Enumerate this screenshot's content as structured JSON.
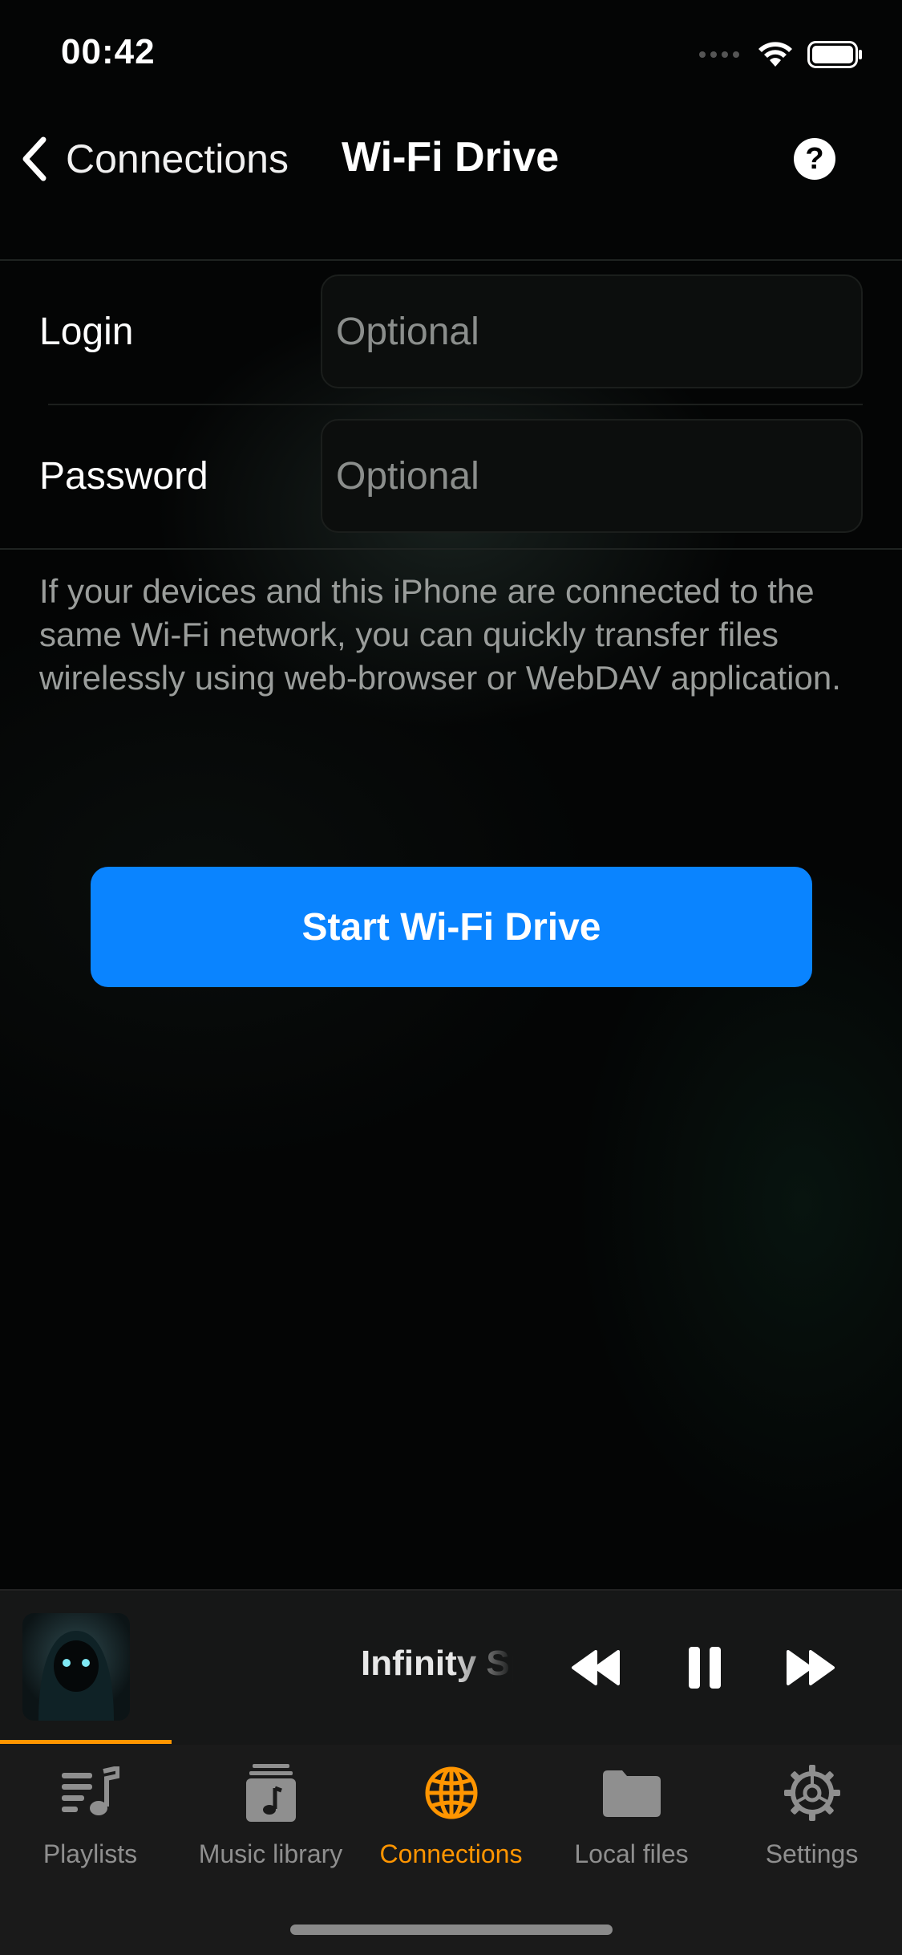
{
  "status_bar": {
    "time": "00:42"
  },
  "nav": {
    "back_label": "Connections",
    "title": "Wi-Fi Drive"
  },
  "form": {
    "login_label": "Login",
    "login_placeholder": "Optional",
    "password_label": "Password",
    "password_placeholder": "Optional"
  },
  "info_text": "If your devices and this iPhone are connected to the same Wi-Fi network, you can quickly transfer files wirelessly using web-browser or WebDAV application.",
  "start_button": "Start Wi-Fi Drive",
  "player": {
    "track_title": "Infinity Sp",
    "playback_progress": 0.19
  },
  "tabs": [
    {
      "label": "Playlists",
      "icon": "playlists-icon"
    },
    {
      "label": "Music library",
      "icon": "music-library-icon"
    },
    {
      "label": "Connections",
      "icon": "globe-icon",
      "active": true
    },
    {
      "label": "Local files",
      "icon": "folder-icon"
    },
    {
      "label": "Settings",
      "icon": "gear-icon"
    }
  ],
  "colors": {
    "accent": "#ff9500",
    "button_blue": "#0a84ff",
    "background": "#050605"
  }
}
